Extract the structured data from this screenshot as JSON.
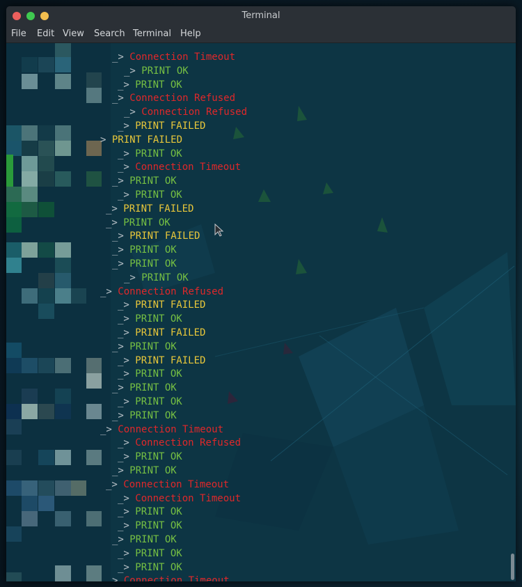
{
  "window": {
    "title": "Terminal"
  },
  "menu": [
    "File",
    "Edit",
    "View",
    "Search",
    "Terminal",
    "Help"
  ],
  "colors": {
    "ok": "#76c043",
    "failed": "#e8c73a",
    "error": "#e0282a",
    "prefix": "#b9c2c8",
    "background": "#0d3544"
  },
  "terminal_lines": [
    {
      "prefix": "_> ",
      "text": "Connection Timeout",
      "status": "error",
      "indent": 18
    },
    {
      "prefix": "_> ",
      "text": "PRINT OK",
      "status": "ok",
      "indent": 20
    },
    {
      "prefix": "_> ",
      "text": "PRINT OK",
      "status": "ok",
      "indent": 19
    },
    {
      "prefix": "_> ",
      "text": "Connection Refused",
      "status": "error",
      "indent": 18
    },
    {
      "prefix": "_> ",
      "text": "Connection Refused",
      "status": "error",
      "indent": 20
    },
    {
      "prefix": "_> ",
      "text": "PRINT FAILED",
      "status": "failed",
      "indent": 19
    },
    {
      "prefix": "> ",
      "text": "PRINT FAILED",
      "status": "failed",
      "indent": 16
    },
    {
      "prefix": "_> ",
      "text": "PRINT OK",
      "status": "ok",
      "indent": 19
    },
    {
      "prefix": "_> ",
      "text": "Connection Timeout",
      "status": "error",
      "indent": 19
    },
    {
      "prefix": "_> ",
      "text": "PRINT OK",
      "status": "ok",
      "indent": 18
    },
    {
      "prefix": "_> ",
      "text": "PRINT OK",
      "status": "ok",
      "indent": 19
    },
    {
      "prefix": "_> ",
      "text": "PRINT FAILED",
      "status": "failed",
      "indent": 17
    },
    {
      "prefix": "_> ",
      "text": "PRINT OK",
      "status": "ok",
      "indent": 17
    },
    {
      "prefix": "_> ",
      "text": "PRINT FAILED",
      "status": "failed",
      "indent": 18
    },
    {
      "prefix": "_> ",
      "text": "PRINT OK",
      "status": "ok",
      "indent": 18
    },
    {
      "prefix": "_> ",
      "text": "PRINT OK",
      "status": "ok",
      "indent": 18
    },
    {
      "prefix": "_> ",
      "text": "PRINT OK",
      "status": "ok",
      "indent": 20
    },
    {
      "prefix": "_> ",
      "text": "Connection Refused",
      "status": "error",
      "indent": 16
    },
    {
      "prefix": "_> ",
      "text": "PRINT FAILED",
      "status": "failed",
      "indent": 19
    },
    {
      "prefix": "_> ",
      "text": "PRINT OK",
      "status": "ok",
      "indent": 19
    },
    {
      "prefix": "_> ",
      "text": "PRINT FAILED",
      "status": "failed",
      "indent": 19
    },
    {
      "prefix": "_> ",
      "text": "PRINT OK",
      "status": "ok",
      "indent": 18
    },
    {
      "prefix": "_> ",
      "text": "PRINT FAILED",
      "status": "failed",
      "indent": 19
    },
    {
      "prefix": "_> ",
      "text": "PRINT OK",
      "status": "ok",
      "indent": 19
    },
    {
      "prefix": "_> ",
      "text": "PRINT OK",
      "status": "ok",
      "indent": 18
    },
    {
      "prefix": "_> ",
      "text": "PRINT OK",
      "status": "ok",
      "indent": 19
    },
    {
      "prefix": "_> ",
      "text": "PRINT OK",
      "status": "ok",
      "indent": 18
    },
    {
      "prefix": "_> ",
      "text": "Connection Timeout",
      "status": "error",
      "indent": 16
    },
    {
      "prefix": "_> ",
      "text": "Connection Refused",
      "status": "error",
      "indent": 19
    },
    {
      "prefix": "_> ",
      "text": "PRINT OK",
      "status": "ok",
      "indent": 19
    },
    {
      "prefix": "_> ",
      "text": "PRINT OK",
      "status": "ok",
      "indent": 18
    },
    {
      "prefix": "_> ",
      "text": "Connection Timeout",
      "status": "error",
      "indent": 17
    },
    {
      "prefix": "_> ",
      "text": "Connection Timeout",
      "status": "error",
      "indent": 19
    },
    {
      "prefix": "_> ",
      "text": "PRINT OK",
      "status": "ok",
      "indent": 19
    },
    {
      "prefix": "_> ",
      "text": "PRINT OK",
      "status": "ok",
      "indent": 19
    },
    {
      "prefix": "_> ",
      "text": "PRINT OK",
      "status": "ok",
      "indent": 18
    },
    {
      "prefix": "_> ",
      "text": "PRINT OK",
      "status": "ok",
      "indent": 19
    },
    {
      "prefix": "_> ",
      "text": "PRINT OK",
      "status": "ok",
      "indent": 19
    },
    {
      "prefix": "> ",
      "text": "Connection Timeout",
      "status": "error",
      "indent": 18
    }
  ]
}
